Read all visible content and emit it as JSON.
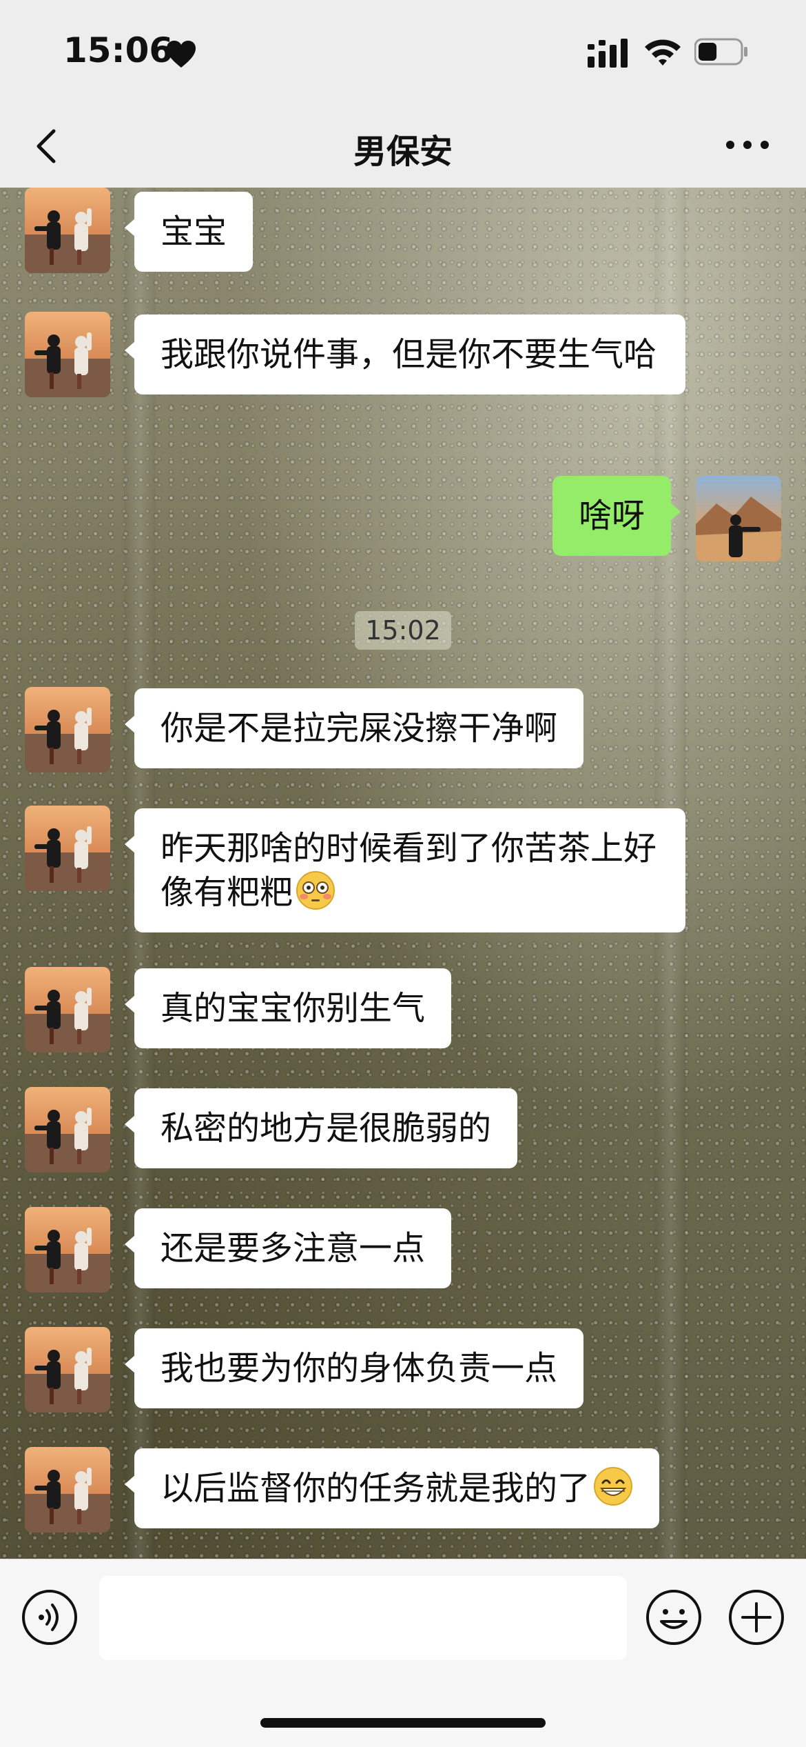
{
  "status_bar": {
    "time": "15:06",
    "heart_icon": "heart-icon",
    "battery_level": 0.45
  },
  "nav": {
    "title": "男保安",
    "back_icon": "chevron-left-icon",
    "more_icon": "more-dots-icon"
  },
  "messages": [
    {
      "from": "friend",
      "text": "宝宝"
    },
    {
      "from": "friend",
      "text": "我跟你说件事，但是你不要生气哈"
    },
    {
      "from": "me",
      "text": "啥呀"
    },
    {
      "type": "time",
      "text": "15:02"
    },
    {
      "from": "friend",
      "text": "你是不是拉完屎没擦干净啊"
    },
    {
      "from": "friend",
      "text": "昨天那啥的时候看到了你苦茶上好像有粑粑",
      "emoji": "flushed-face-emoji"
    },
    {
      "from": "friend",
      "text": "真的宝宝你别生气"
    },
    {
      "from": "friend",
      "text": "私密的地方是很脆弱的"
    },
    {
      "from": "friend",
      "text": "还是要多注意一点"
    },
    {
      "from": "friend",
      "text": "我也要为你的身体负责一点"
    },
    {
      "from": "friend",
      "text": "以后监督你的任务就是我的了",
      "emoji": "grinning-face-emoji"
    }
  ],
  "input_bar": {
    "voice_icon": "voice-icon",
    "emoji_icon": "smile-icon",
    "plus_icon": "plus-icon",
    "input_value": ""
  },
  "colors": {
    "outgoing_bubble": "#95ec69",
    "incoming_bubble": "#ffffff",
    "bar_background": "#ededed"
  }
}
